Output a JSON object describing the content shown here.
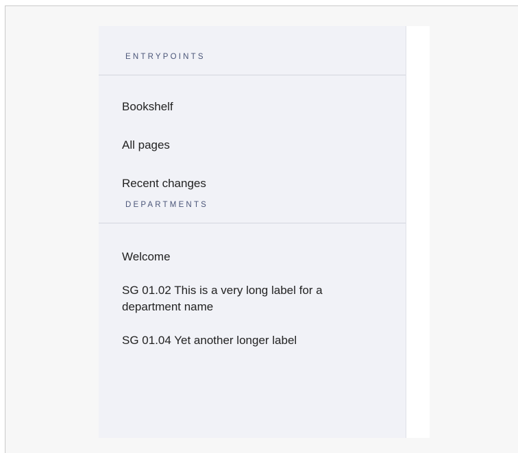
{
  "sidebar": {
    "entrypoints": {
      "title": "ENTRYPOINTS",
      "items": [
        {
          "label": "Bookshelf"
        },
        {
          "label": "All pages"
        },
        {
          "label": "Recent changes"
        }
      ]
    },
    "departments": {
      "title": "DEPARTMENTS",
      "items": [
        {
          "label": "Welcome"
        },
        {
          "label": "SG 01.02 This is a very long label for a department name"
        },
        {
          "label": "SG 01.04 Yet another longer label"
        }
      ]
    }
  },
  "colors": {
    "sidebar_bg": "#f1f2f7",
    "header_text": "#4a5578",
    "item_text": "#222222",
    "page_bg": "#f7f7f7"
  }
}
